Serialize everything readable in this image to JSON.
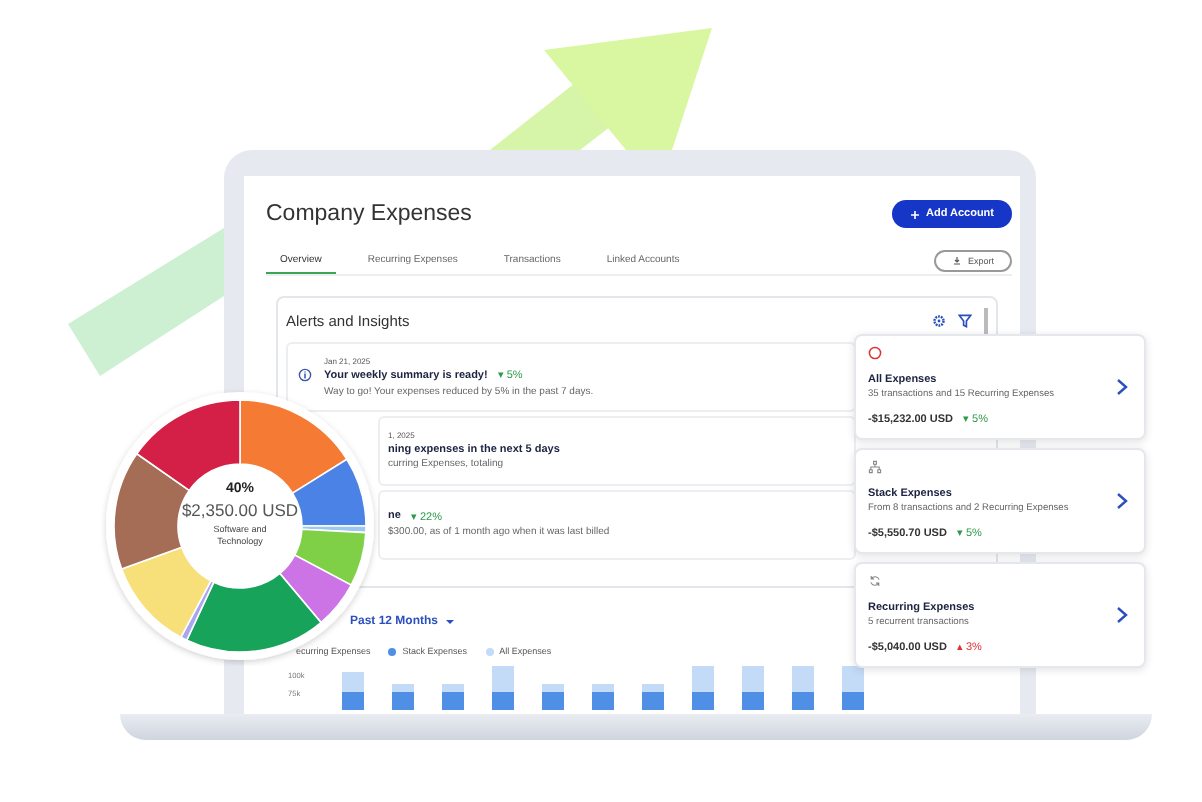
{
  "app": {
    "title": "Company Expenses",
    "add_button": "Add Account",
    "export_button": "Export",
    "tabs": [
      {
        "label": "Overview",
        "selected": true
      },
      {
        "label": "Recurring Expenses",
        "selected": false
      },
      {
        "label": "Transactions",
        "selected": false
      },
      {
        "label": "Linked Accounts",
        "selected": false
      }
    ]
  },
  "alerts": {
    "title": "Alerts and Insights",
    "items": [
      {
        "kind": "info",
        "date": "Jan 21, 2025",
        "title": "Your weekly summary is ready!",
        "change": {
          "text": "▾ 5%",
          "color": "#2e9a4b"
        },
        "body": "Way to go! Your expenses reduced by 5% in the past 7 days."
      },
      {
        "kind": "covered",
        "date": "1, 2025",
        "title": "ning expenses in the next 5 days",
        "body": "curring Expenses, totaling"
      },
      {
        "kind": "covered",
        "title": "ne",
        "change": {
          "text": "▾ 22%",
          "color": "#2e9a4b"
        },
        "body": "$300.00, as of 1 month ago when it was last billed"
      }
    ]
  },
  "chart": {
    "period": "Past 12 Months",
    "legend": [
      {
        "label": "ecurring Expenses"
      },
      {
        "label": "Stack Expenses",
        "color": "#4f8fe6"
      },
      {
        "label": "All Expenses",
        "color": "#c4dbf7"
      }
    ],
    "ticks": [
      "100k",
      "75k"
    ]
  },
  "donut": {
    "percent": "40%",
    "amount": "$2,350.00 USD",
    "category": "Software and Technology"
  },
  "summary_cards": [
    {
      "kind": "alert",
      "title": "All Expenses",
      "subtitle": "35 transactions and 15 Recurring Expenses",
      "amount": "-$15,232.00 USD",
      "change": {
        "text": "▾ 5%",
        "color": "#2e9a4b"
      }
    },
    {
      "kind": "hierarchy",
      "title": "Stack Expenses",
      "subtitle": "From 8 transactions and 2 Recurring Expenses",
      "amount": "-$5,550.70 USD",
      "change": {
        "text": "▾ 5%",
        "color": "#2e9a4b"
      }
    },
    {
      "kind": "recurring",
      "title": "Recurring Expenses",
      "subtitle": "5 recurrent transactions",
      "amount": "-$5,040.00 USD",
      "change": {
        "text": "▴ 3%",
        "color": "#dd3333"
      }
    }
  ]
}
